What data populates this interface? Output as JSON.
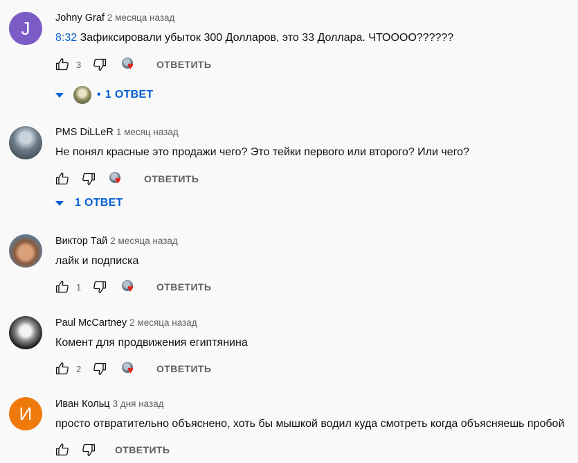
{
  "like_icon": "thumbs-up-icon",
  "dislike_icon": "thumbs-down-icon",
  "reply_label": "ОТВЕТИТЬ",
  "colors": {
    "link": "#065fd4",
    "heart": "#e62117",
    "secondary_text": "#606060"
  },
  "comments": [
    {
      "avatar_letter": "J",
      "avatar_color": "#7b5cc4",
      "author": "Johny Graf",
      "time": "2 месяца назад",
      "timestamp": "8:32",
      "text": "Зафиксировали убыток 300 Долларов, это 33 Доллара. ЧТОООО??????",
      "likes": "3",
      "replies_label": "1 ОТВЕТ"
    },
    {
      "author": "PMS DiLLeR",
      "time": "1 месяц назад",
      "text": "Не понял красные это продажи чего? Это тейки первого или второго? Или чего?",
      "likes": "",
      "replies_label": "1 ОТВЕТ"
    },
    {
      "author": "Виктор Тай",
      "time": "2 месяца назад",
      "text": "лайк и подписка",
      "likes": "1"
    },
    {
      "author": "Paul McCartney",
      "time": "2 месяца назад",
      "text": "Комент для продвижения египтянина",
      "likes": "2"
    },
    {
      "avatar_letter": "И",
      "avatar_color": "#ef7a0c",
      "author": "Иван Кольц",
      "time": "3 дня назад",
      "text": "просто отвратительно объяснено, хоть бы мышкой водил куда смотреть когда объясняешь пробой",
      "likes": ""
    }
  ]
}
